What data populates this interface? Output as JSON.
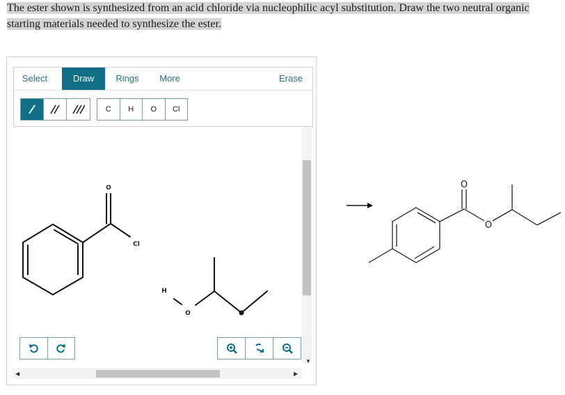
{
  "question": {
    "line1": "The ester shown is synthesized from an acid chloride via nucleophilic acyl substitution. Draw the two neutral organic",
    "line2": "starting materials needed to synthesize the ester."
  },
  "toolbar": {
    "tabs": [
      "Select",
      "Draw",
      "Rings",
      "More"
    ],
    "erase_label": "Erase",
    "bond_tools": [
      "single-bond",
      "double-bond",
      "triple-bond"
    ],
    "atoms": [
      "C",
      "H",
      "O",
      "Cl"
    ]
  },
  "canvas": {
    "atom_labels": {
      "acyl_oxygen": "O",
      "acyl_chlorine": "Cl",
      "alcohol_hydrogen": "H",
      "alcohol_oxygen": "O"
    }
  },
  "target": {
    "carbonyl_oxygen": "O",
    "ester_oxygen": "O"
  },
  "colors": {
    "accent": "#0e6f86",
    "border": "#7a9ea8"
  }
}
